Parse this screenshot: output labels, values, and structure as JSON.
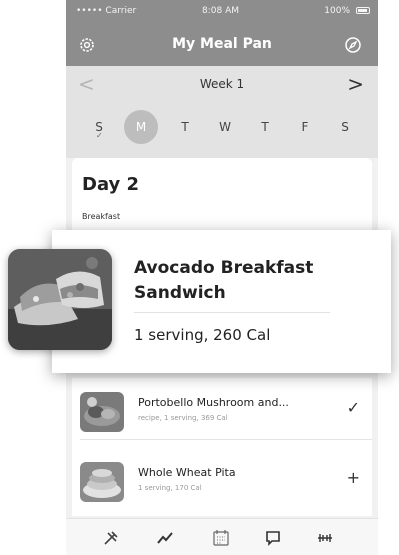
{
  "status_bar": {
    "carrier": "••••• Carrier",
    "time": "8:08 AM",
    "battery": "100%"
  },
  "nav": {
    "title": "My Meal Pan",
    "left_icon": "gear-icon",
    "right_icon": "compass-icon"
  },
  "week": {
    "label": "Week 1",
    "prev_glyph": "<",
    "next_glyph": ">",
    "days": [
      {
        "label": "S",
        "selected": false,
        "checked": true
      },
      {
        "label": "M",
        "selected": true,
        "checked": false
      },
      {
        "label": "T",
        "selected": false,
        "checked": false
      },
      {
        "label": "W",
        "selected": false,
        "checked": false
      },
      {
        "label": "T",
        "selected": false,
        "checked": false
      },
      {
        "label": "F",
        "selected": false,
        "checked": false
      },
      {
        "label": "S",
        "selected": false,
        "checked": false
      }
    ]
  },
  "day_card": {
    "title": "Day 2",
    "section": "Breakfast"
  },
  "floating_card": {
    "name": "Avocado Breakfast Sandwich",
    "serving": "1 serving, 260 Cal"
  },
  "list": {
    "items": [
      {
        "name": "Portobello Mushroom and...",
        "meta": "recipe, 1 serving, 369 Cal",
        "action": "✓",
        "action_icon": "checkmark-icon"
      },
      {
        "name": "Whole Wheat Pita",
        "meta": "1 serving, 170 Cal",
        "action": "+",
        "action_icon": "plus-icon"
      }
    ]
  },
  "tab_bar": {
    "icons": [
      "food-icon",
      "trend-icon",
      "calendar-icon",
      "chat-icon",
      "dumbbell-icon"
    ]
  },
  "colors": {
    "header": "#8d8d8d",
    "week_bar": "#e3e3e3",
    "selected_day": "#bdbdbd"
  }
}
